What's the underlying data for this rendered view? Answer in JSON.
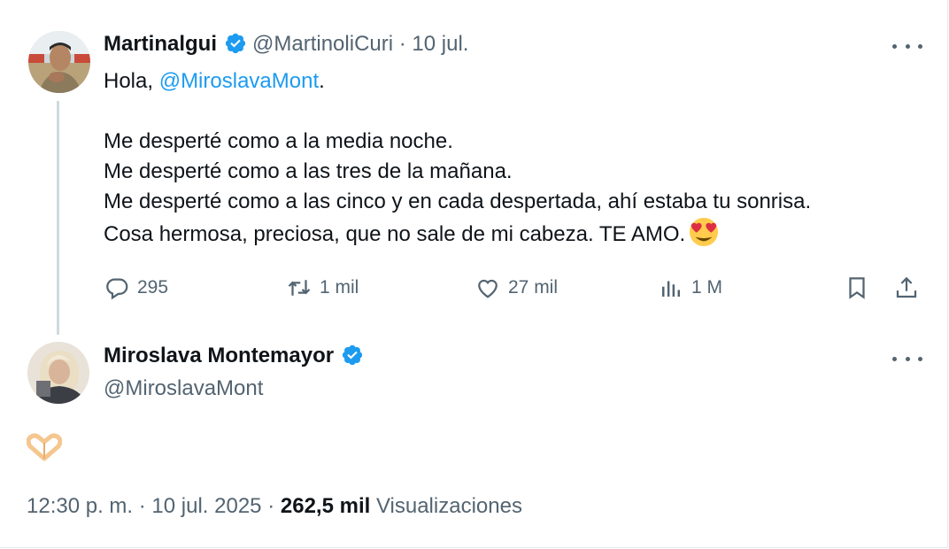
{
  "reply_tweet": {
    "author_name": "Martinalgui",
    "author_handle": "@MartinoliCuri",
    "separator": "·",
    "date": "10 jul.",
    "text_intro": "Hola, ",
    "text_mention": "@MiroslavaMont",
    "text_period": ".",
    "lines": [
      "Me desperté como a la media noche.",
      "Me desperté como a las tres de la mañana.",
      "Me desperté como a las cinco y en cada despertada, ahí estaba tu sonrisa.",
      "Cosa hermosa, preciosa, que no sale de mi cabeza. TE AMO."
    ],
    "emoji": "smiling-face-with-heart-eyes",
    "actions": {
      "replies": "295",
      "retweets": "1 mil",
      "likes": "27 mil",
      "views": "1 M"
    }
  },
  "main_tweet": {
    "author_name": "Miroslava Montemayor",
    "author_handle": "@MiroslavaMont",
    "content_emoji": "heart-hands",
    "time": "12:30 p. m.",
    "separator": "·",
    "date": "10 jul. 2025",
    "separator2": "·",
    "views_count": "262,5 mil",
    "views_label": "Visualizaciones"
  },
  "colors": {
    "accent": "#1d9bf0",
    "text": "#0f1419",
    "muted": "#536471",
    "thread_line": "#cfd9de"
  }
}
